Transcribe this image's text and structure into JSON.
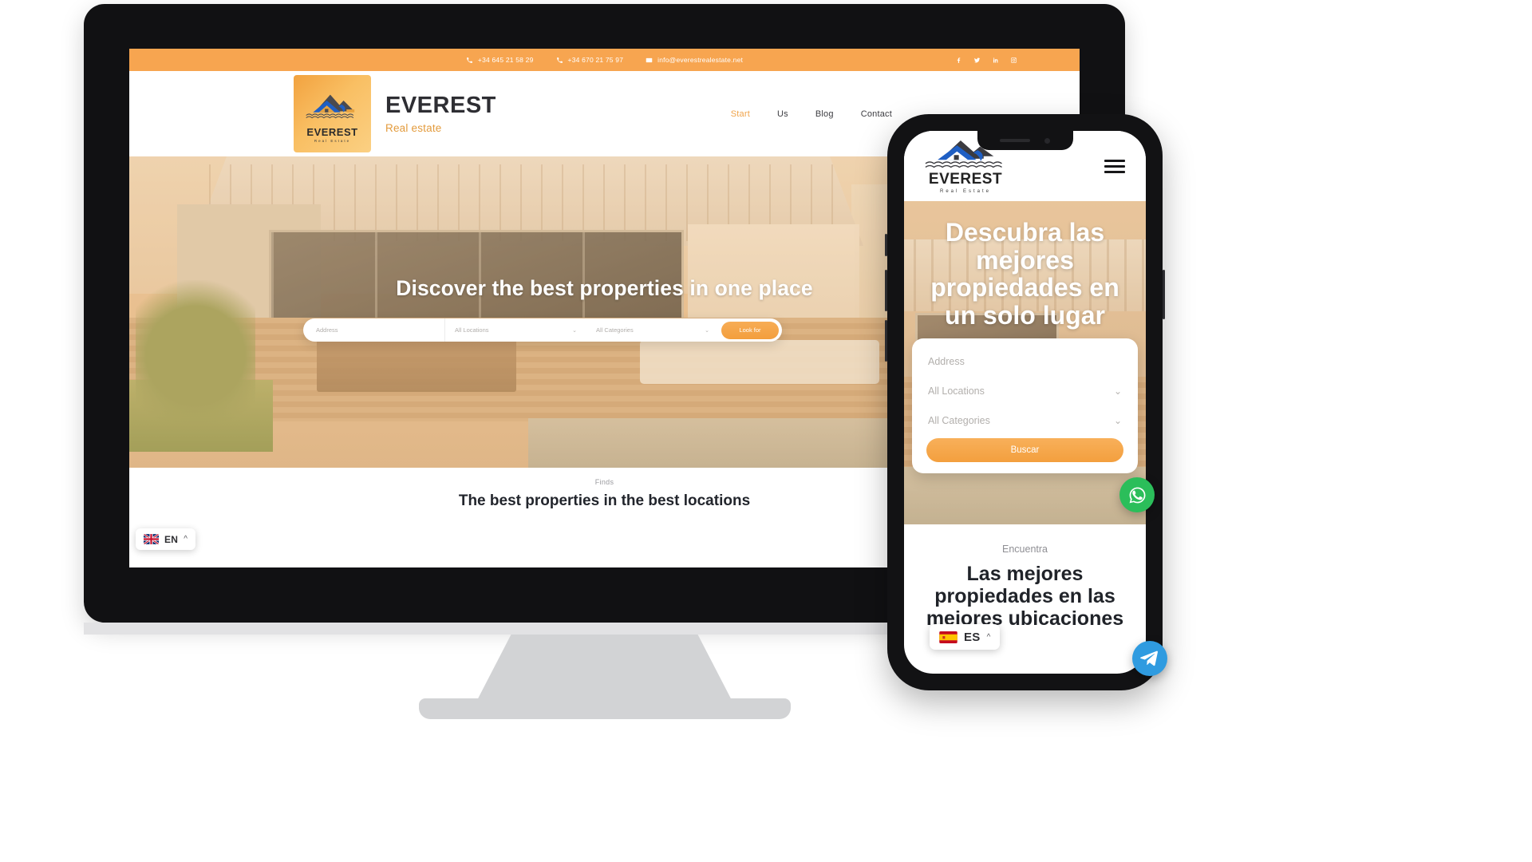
{
  "desktop": {
    "topbar": {
      "phone1": "+34 645 21 58 29",
      "phone2": "+34 670 21 75 97",
      "email": "info@everestrealestate.net",
      "social": [
        "facebook-icon",
        "twitter-icon",
        "linkedin-icon",
        "instagram-icon"
      ],
      "background_color": "#f7a550"
    },
    "brand": {
      "logo_badge_name": "EVEREST",
      "logo_badge_sub": "Real Estate",
      "title": "EVEREST",
      "subtitle": "Real estate",
      "accent_color": "#e39b3d"
    },
    "nav": [
      {
        "label": "Start",
        "active": true
      },
      {
        "label": "Us",
        "active": false
      },
      {
        "label": "Blog",
        "active": false
      },
      {
        "label": "Contact",
        "active": false
      }
    ],
    "hero": {
      "title": "Discover the best properties in one place",
      "search": {
        "address_placeholder": "Address",
        "location_value": "All Locations",
        "category_value": "All Categories",
        "button_label": "Look for"
      }
    },
    "finds": {
      "label": "Finds",
      "title": "The best properties in the best locations"
    },
    "language": {
      "code": "EN",
      "flag": "uk-flag-icon",
      "caret": "^"
    },
    "fab": {
      "name": "telegram-fab",
      "color": "#2f9be0"
    }
  },
  "phone": {
    "brand": {
      "logo_badge_name": "EVEREST",
      "logo_badge_sub": "Real Estate"
    },
    "menu_icon": "hamburger-menu-icon",
    "hero": {
      "title": "Descubra las mejores propiedades en un solo lugar",
      "search": {
        "address_placeholder": "Address",
        "location_value": "All Locations",
        "category_value": "All Categories",
        "button_label": "Buscar"
      }
    },
    "finds": {
      "label": "Encuentra",
      "title": "Las mejores propiedades en las mejores ubicaciones"
    },
    "language": {
      "code": "ES",
      "flag": "spain-flag-icon",
      "caret": "^"
    },
    "whatsapp_fab": {
      "name": "whatsapp-fab",
      "color": "#2bbe5a"
    },
    "telegram_fab": {
      "name": "telegram-fab",
      "color": "#2f9be0"
    }
  }
}
